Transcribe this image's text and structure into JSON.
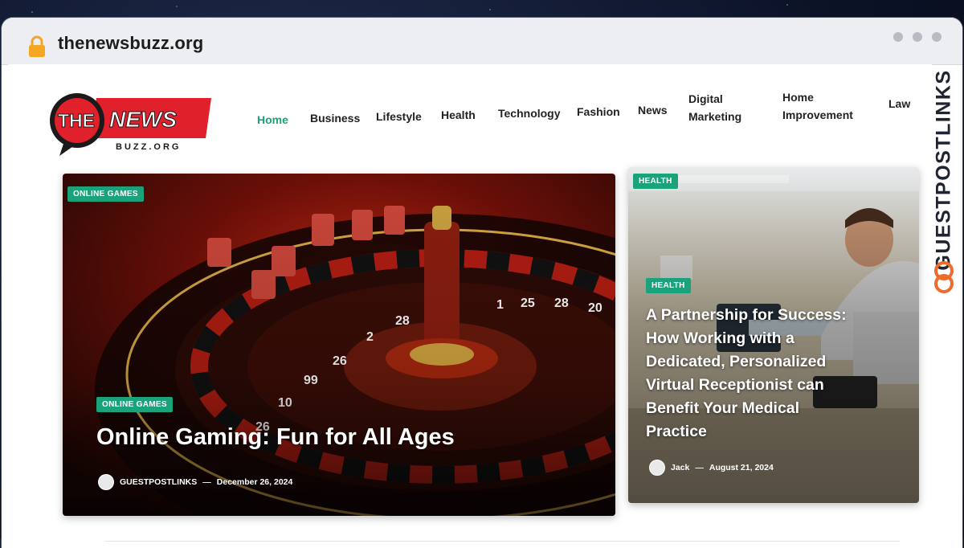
{
  "browser": {
    "url": "thenewsbuzz.org"
  },
  "logo": {
    "word1": "THE",
    "word2": "NEWS",
    "sub": "BUZZ.ORG"
  },
  "nav": {
    "items": [
      {
        "label": "Home",
        "active": true
      },
      {
        "label": "Business"
      },
      {
        "label": "Lifestyle"
      },
      {
        "label": "Health"
      },
      {
        "label": "Technology"
      },
      {
        "label": "Fashion"
      },
      {
        "label": "News"
      },
      {
        "label": "Digital Marketing",
        "line1": "Digital",
        "line2": "Marketing"
      },
      {
        "label": "Home Improvement",
        "line1": "Home",
        "line2": "Improvement"
      },
      {
        "label": "Law"
      }
    ]
  },
  "side_brand": {
    "text": "GUESTPOSTLINKS"
  },
  "featured": {
    "top_badge": "ONLINE GAMES",
    "badge": "ONLINE GAMES",
    "title": "Online Gaming: Fun for All Ages",
    "author": "GUESTPOSTLINKS",
    "separator": "—",
    "date": "December 26, 2024",
    "roulette_numbers": [
      "1",
      "25",
      "28",
      "20",
      "2",
      "28",
      "26",
      "99",
      "10",
      "26"
    ]
  },
  "secondary": {
    "top_badge": "HEALTH",
    "badge": "HEALTH",
    "title": "A Partnership for Success: How Working with a Dedicated, Personalized Virtual Receptionist can Benefit Your Medical Practice",
    "author": "Jack",
    "separator": "—",
    "date": "August 21, 2024"
  },
  "colors": {
    "accent": "#1aa37a",
    "logo_red": "#e0202a",
    "page_bg": "#ffffff"
  }
}
